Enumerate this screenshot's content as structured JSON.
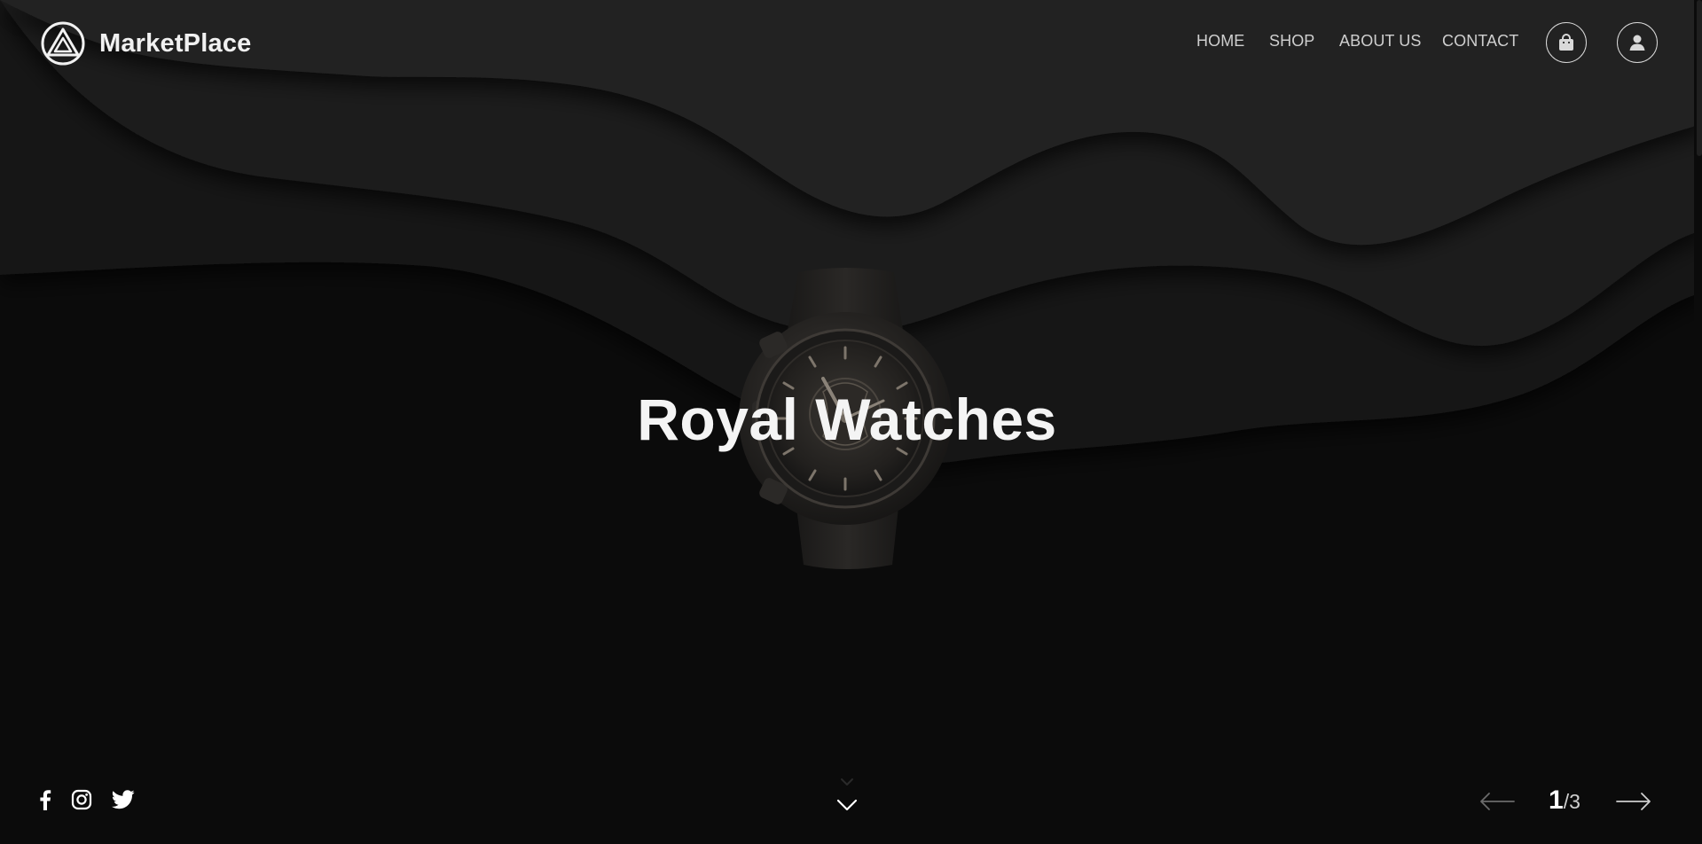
{
  "brand": {
    "name": "MarketPlace"
  },
  "nav": {
    "items": [
      {
        "label": "HOME"
      },
      {
        "label": "SHOP"
      },
      {
        "label": "ABOUT US"
      },
      {
        "label": "CONTACT"
      }
    ],
    "cart_icon": "shopping-bag-icon",
    "account_icon": "user-icon"
  },
  "hero": {
    "title": "Royal Watches",
    "image": "black-watch"
  },
  "social": {
    "icons": [
      "facebook-icon",
      "instagram-icon",
      "twitter-icon"
    ]
  },
  "scroll_hint": {
    "icon": "chevron-down-icon"
  },
  "slider": {
    "current": "1",
    "separator": "/",
    "total": "3",
    "prev_icon": "arrow-left-icon",
    "next_icon": "arrow-right-icon"
  },
  "colors": {
    "background": "#0b0b0b",
    "wave_top": "#232323",
    "wave_mid": "#1b1b1b",
    "wave_low": "#141414",
    "text": "#f4f4f4",
    "nav_text": "#cfcfcf"
  }
}
